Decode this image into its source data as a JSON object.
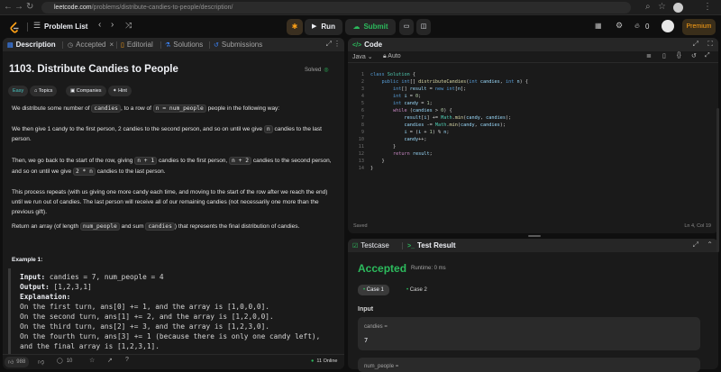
{
  "browser": {
    "url_host": "leetcode.com",
    "url_path": "/problems/distribute-candies-to-people/description/"
  },
  "header": {
    "problem_list": "Problem List",
    "run": "Run",
    "submit": "Submit",
    "premium": "Premium",
    "streak": "0"
  },
  "left_tabs": {
    "description": "Description",
    "accepted": "Accepted",
    "editorial": "Editorial",
    "solutions": "Solutions",
    "submissions": "Submissions"
  },
  "problem": {
    "title": "1103. Distribute Candies to People",
    "solved": "Solved",
    "tags": {
      "difficulty": "Easy",
      "topics": "Topics",
      "companies": "Companies",
      "hint": "Hint"
    },
    "p1_a": "We distribute some number of ",
    "p1_c1": "candies",
    "p1_b": ", to a row of ",
    "p1_c2": "n = num_people",
    "p1_d": " people in the following way:",
    "p2_l1": "We then give 1 candy to the first person, 2 candies to the second person, and so on until we give ",
    "p2_c": "n",
    "p2_l1b": " candies to the last",
    "p2_l2": "person.",
    "p3_a": "Then, we go back to the start of the row, giving ",
    "p3_c1": "n + 1",
    "p3_b": " candies to the first person, ",
    "p3_c2": "n + 2",
    "p3_c": " candies to the second person,",
    "p3_l2a": "and so on until we give ",
    "p3_c3": "2 * n",
    "p3_l2b": " candies to the last person.",
    "p4_l1": "This process repeats (with us giving one more candy each time, and moving to the start of the row after we reach the end)",
    "p4_l2": "until we run out of candies.  The last person will receive all of our remaining candies (not necessarily one more than the",
    "p4_l3": "previous gift).",
    "p5_a": "Return an array (of length ",
    "p5_c1": "num_people",
    "p5_b": " and sum ",
    "p5_c2": "candies",
    "p5_c": ") that represents the final distribution of candies.",
    "example_heading": "Example 1:",
    "ex_input_label": "Input:",
    "ex_input": " candies = 7, num_people = 4",
    "ex_output_label": "Output:",
    "ex_output": " [1,2,3,1]",
    "ex_expl_label": "Explanation:",
    "ex_lines": [
      "On the first turn, ans[0] += 1, and the array is [1,0,0,0].",
      "On the second turn, ans[1] += 2, and the array is [1,2,0,0].",
      "On the third turn, ans[2] += 3, and the array is [1,2,3,0].",
      "On the fourth turn, ans[3] += 1 (because there is only one candy left),",
      "and the final array is [1,2,3,1]."
    ]
  },
  "desc_footer": {
    "likes": "988",
    "comments": "10",
    "online": "11 Online"
  },
  "code_panel": {
    "title": "Code",
    "language": "Java",
    "auto": "Auto",
    "saved": "Saved",
    "cursor": "Ln 4, Col 19",
    "line_numbers": [
      "1",
      "2",
      "3",
      "4",
      "5",
      "6",
      "7",
      "8",
      "9",
      "10",
      "11",
      "12",
      "13",
      "14"
    ]
  },
  "result_panel": {
    "tab_testcase": "Testcase",
    "tab_result": "Test Result",
    "status": "Accepted",
    "runtime": "Runtime: 0 ms",
    "case1": "Case 1",
    "case2": "Case 2",
    "input_label": "Input",
    "param1_name": "candies =",
    "param1_value": "7",
    "param2_name": "num_people ="
  },
  "colors": {
    "accepted": "#2cbb5d",
    "easy": "#46c6c2",
    "submit": "#2cbb5d",
    "premium": "#ffa116"
  }
}
